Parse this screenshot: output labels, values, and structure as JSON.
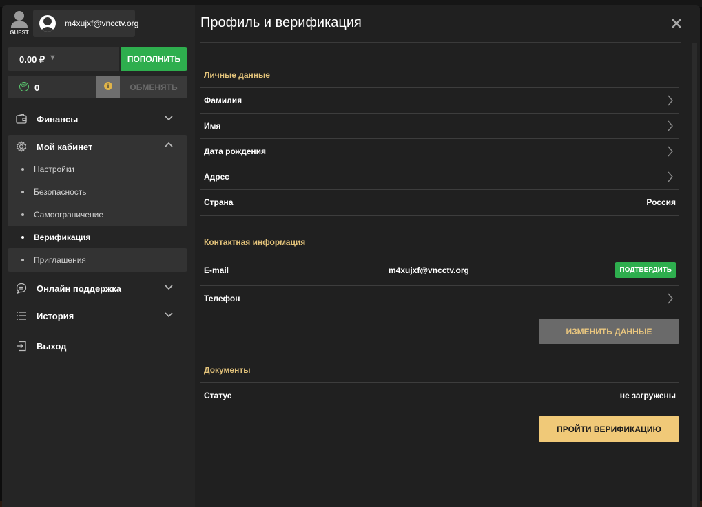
{
  "user": {
    "guest_label": "GUEST",
    "email": "m4xujxf@vncctv.org"
  },
  "balance": {
    "amount": "0.00 ₽",
    "caret": "▼",
    "deposit_label": "ПОПОЛНИТЬ"
  },
  "cp": {
    "icon_text": "CP",
    "value": "0",
    "info_icon": "i",
    "exchange_label": "ОБМЕНЯТЬ"
  },
  "nav": {
    "finance": "Финансы",
    "cabinet": "Мой кабинет",
    "sub": [
      "Настройки",
      "Безопасность",
      "Самоограничение",
      "Верификация",
      "Приглашения"
    ],
    "support": "Онлайн поддержка",
    "history": "История",
    "logout": "Выход"
  },
  "main": {
    "title": "Профиль и верификация",
    "personal_header": "Личные данные",
    "personal_rows": [
      {
        "label": "Фамилия",
        "value": ""
      },
      {
        "label": "Имя",
        "value": ""
      },
      {
        "label": "Дата рождения",
        "value": ""
      },
      {
        "label": "Адрес",
        "value": ""
      },
      {
        "label": "Страна",
        "value": "Россия"
      }
    ],
    "contact_header": "Контактная информация",
    "email_label": "E-mail",
    "email_value": "m4xujxf@vncctv.org",
    "confirm_label": "ПОДТВЕРДИТЬ",
    "phone_label": "Телефон",
    "change_label": "ИЗМЕНИТЬ ДАННЫЕ",
    "docs_header": "Документы",
    "status_label": "Статус",
    "status_value": "не загружены",
    "verify_label": "ПРОЙТИ ВЕРИФИКАЦИЮ"
  },
  "colors": {
    "accent_green": "#2eae4e",
    "accent_gold": "#f0c978",
    "section_header": "#e2c27a"
  }
}
